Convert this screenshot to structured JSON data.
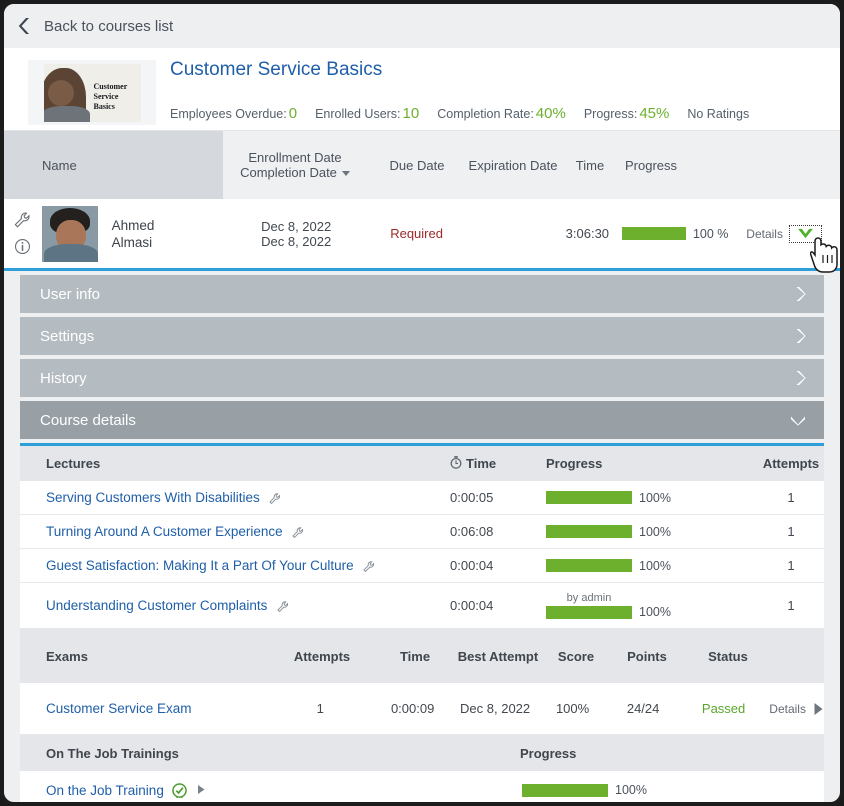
{
  "topbar": {
    "back_label": "Back to courses list",
    "back_icon": "chevron-left-icon"
  },
  "course": {
    "title": "Customer Service Basics",
    "thumbnail_caption": "Customer Service Basics",
    "stats": [
      {
        "label": "Employees Overdue:",
        "value": "0"
      },
      {
        "label": "Enrolled Users:",
        "value": "10"
      },
      {
        "label": "Completion Rate:",
        "value": "40%"
      },
      {
        "label": "Progress:",
        "value": "45%"
      }
    ],
    "ratings": "No Ratings"
  },
  "users_table": {
    "headers": {
      "name": "Name",
      "enrollment_date": "Enrollment Date",
      "completion_date": "Completion Date",
      "due_date": "Due Date",
      "expiration_date": "Expiration Date",
      "time": "Time",
      "progress": "Progress"
    },
    "row": {
      "wrench_icon": "wrench-icon",
      "info_icon": "info-icon",
      "first_name": "Ahmed",
      "last_name": "Almasi",
      "enrollment_date": "Dec 8, 2022",
      "completion_date": "Dec 8, 2022",
      "due_date": "Required",
      "expiration_date": "",
      "time": "3:06:30",
      "progress_pct": 100,
      "progress_label": "100 %",
      "details_label": "Details"
    }
  },
  "accordion": [
    {
      "label": "User info",
      "expanded": false
    },
    {
      "label": "Settings",
      "expanded": false
    },
    {
      "label": "History",
      "expanded": false
    },
    {
      "label": "Course details",
      "expanded": true
    }
  ],
  "lectures": {
    "headers": {
      "name": "Lectures",
      "time": "Time",
      "progress": "Progress",
      "attempts": "Attempts"
    },
    "time_icon": "stopwatch-icon",
    "rows": [
      {
        "name": "Serving Customers With Disabilities",
        "time": "0:00:05",
        "progress_pct": 100,
        "progress_label": "100%",
        "attempts": "1",
        "note": ""
      },
      {
        "name": "Turning Around A Customer Experience",
        "time": "0:06:08",
        "progress_pct": 100,
        "progress_label": "100%",
        "attempts": "1",
        "note": ""
      },
      {
        "name": "Guest Satisfaction: Making It a Part Of Your Culture",
        "time": "0:00:04",
        "progress_pct": 100,
        "progress_label": "100%",
        "attempts": "1",
        "note": ""
      },
      {
        "name": "Understanding Customer Complaints",
        "time": "0:00:04",
        "progress_pct": 100,
        "progress_label": "100%",
        "attempts": "1",
        "note": "by admin"
      }
    ]
  },
  "exams": {
    "headers": {
      "name": "Exams",
      "attempts": "Attempts",
      "time": "Time",
      "best_attempt": "Best Attempt",
      "score": "Score",
      "points": "Points",
      "status": "Status"
    },
    "rows": [
      {
        "name": "Customer Service Exam",
        "attempts": "1",
        "time": "0:00:09",
        "best_attempt": "Dec 8, 2022",
        "score": "100%",
        "points": "24/24",
        "status": "Passed",
        "details_label": "Details"
      }
    ]
  },
  "ojt": {
    "headers": {
      "name": "On The Job Trainings",
      "progress": "Progress"
    },
    "rows": [
      {
        "name": "On the Job Training",
        "badge_icon": "certified-check-icon",
        "progress_pct": 100,
        "progress_label": "100%"
      }
    ]
  },
  "colors": {
    "accent_blue": "#2e9fd8",
    "link_blue": "#1f5fa9",
    "green": "#6cb02e",
    "required_red": "#9e2a2a",
    "header_gray": "#eef0f2",
    "accordion_gray": "#b4bcc2",
    "accordion_active": "#98a0a6"
  }
}
